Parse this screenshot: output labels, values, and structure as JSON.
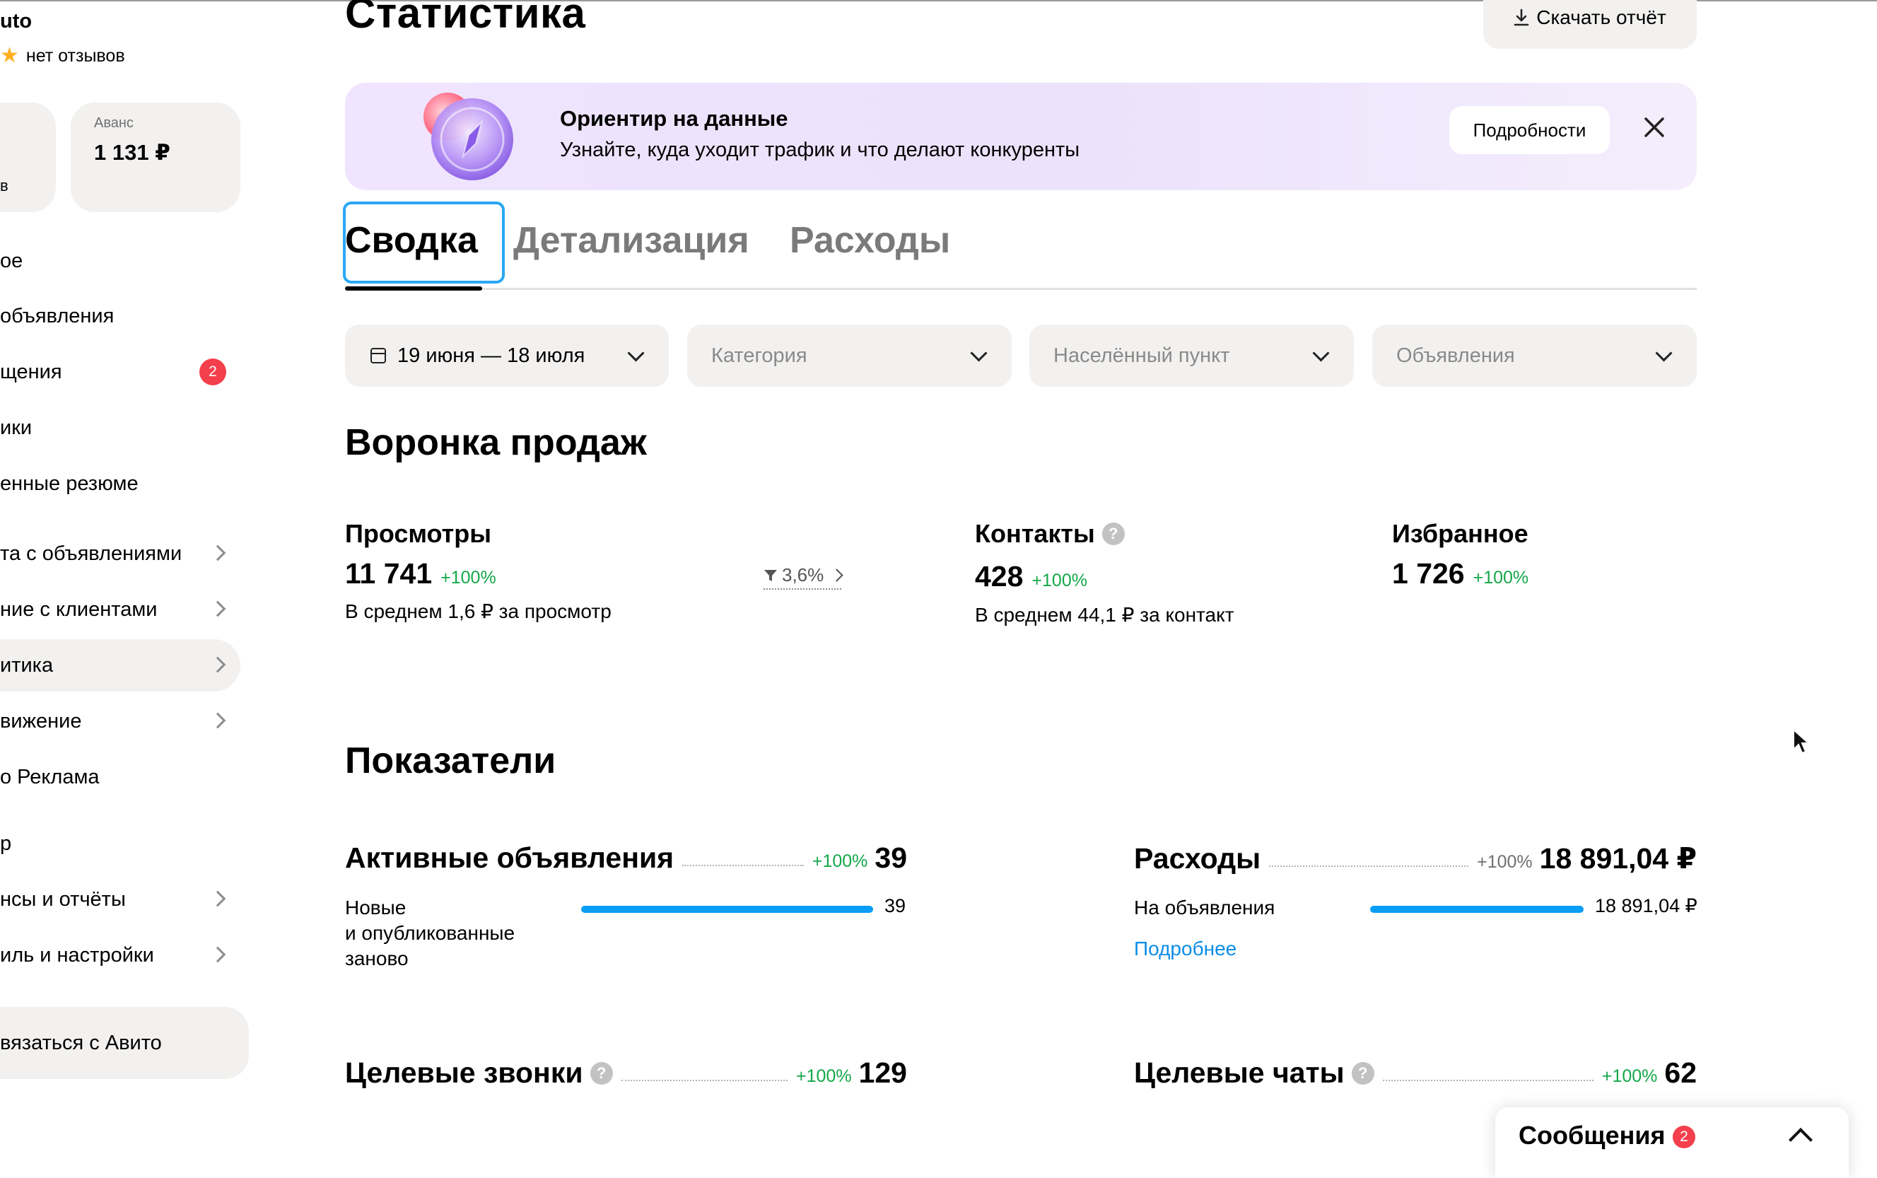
{
  "sidebar": {
    "brand": "uto",
    "rating_text": "нет отзывов",
    "card1_suffix": "в",
    "card2": {
      "label": "Аванс",
      "value": "1 131 ₽"
    },
    "items": [
      {
        "label": "ое"
      },
      {
        "label": "объявления"
      },
      {
        "label": "щения",
        "badge": "2"
      },
      {
        "label": "ики"
      },
      {
        "label": "енные резюме"
      },
      {
        "label": "та с объявлениями"
      },
      {
        "label": "ние с клиентами"
      },
      {
        "label": "итика"
      },
      {
        "label": "вижение"
      },
      {
        "label": "о Реклама"
      },
      {
        "label": "р"
      },
      {
        "label": "нсы и отчёты"
      },
      {
        "label": "иль и настройки"
      }
    ],
    "contact_button": "вязаться с Авито"
  },
  "header": {
    "title": "Статистика",
    "download_button": "Скачать отчёт"
  },
  "banner": {
    "title": "Ориентир на данные",
    "text": "Узнайте, куда уходит трафик и что делают конкуренты",
    "more_button": "Подробности"
  },
  "tabs": [
    {
      "label": "Сводка"
    },
    {
      "label": "Детализация"
    },
    {
      "label": "Расходы"
    }
  ],
  "filters": {
    "period": "19 июня — 18 июля",
    "category_placeholder": "Категория",
    "location_placeholder": "Населённый пункт",
    "ads_placeholder": "Объявления"
  },
  "funnel": {
    "title": "Воронка продаж",
    "views": {
      "label": "Просмотры",
      "value": "11 741",
      "delta": "+100%",
      "sub": "В среднем 1,6 ₽ за просмотр",
      "conversion": "3,6%"
    },
    "contacts": {
      "label": "Контакты",
      "value": "428",
      "delta": "+100%",
      "sub": "В среднем 44,1 ₽ за контакт"
    },
    "favorites": {
      "label": "Избранное",
      "value": "1 726",
      "delta": "+100%"
    }
  },
  "indicators": {
    "title": "Показатели",
    "active_ads": {
      "label": "Активные объявления",
      "delta": "+100%",
      "value": "39",
      "bar_label": "Новые\nи опубликованные\nзаново",
      "bar_value": "39",
      "bar_fraction": 1.0
    },
    "expenses": {
      "label": "Расходы",
      "delta": "+100%",
      "value": "18 891,04 ₽",
      "bar_label": "На объявления",
      "bar_value": "18 891,04 ₽",
      "bar_fraction": 1.0,
      "link": "Подробнее"
    },
    "target_calls": {
      "label": "Целевые звонки",
      "delta": "+100%",
      "value": "129"
    },
    "target_chats": {
      "label": "Целевые чаты",
      "delta": "+100%",
      "value": "62"
    }
  },
  "messages_widget": {
    "label": "Сообщения",
    "badge": "2"
  },
  "colors": {
    "accent": "#0a9df5",
    "positive": "#14a84a",
    "badge": "#f43f4c",
    "surface": "#f2f1f0"
  }
}
